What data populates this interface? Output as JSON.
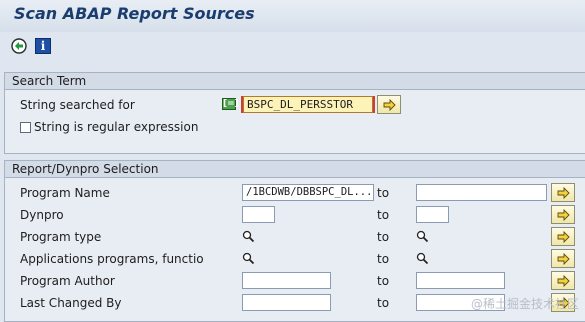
{
  "window": {
    "title": "Scan ABAP Report Sources"
  },
  "toolbar": {
    "execute_icon": "execute-icon",
    "info_icon": "info-icon",
    "info_glyph": "i"
  },
  "search_term": {
    "header": "Search Term",
    "string_label": "String searched for",
    "string_value": "BSPC_DL_PERSSTOR",
    "regex_label": "String is regular expression",
    "match_icon_glyph": "[=]"
  },
  "selection": {
    "header": "Report/Dynpro Selection",
    "to_label": "to",
    "rows": [
      {
        "label": "Program Name",
        "from": "/1BCDWB/DBBSPC_DL...",
        "to": ""
      },
      {
        "label": "Dynpro",
        "from": "",
        "to": ""
      },
      {
        "label": "Program type",
        "from": "",
        "to": ""
      },
      {
        "label": "Applications programs, functio",
        "from": "",
        "to": ""
      },
      {
        "label": "Program Author",
        "from": "",
        "to": ""
      },
      {
        "label": "Last Changed By",
        "from": "",
        "to": ""
      }
    ]
  },
  "watermark": "@稀土掘金技术社区",
  "colors": {
    "title": "#1a3d6e",
    "highlight_field": "#fdf3b8",
    "arrow_button": "#f1e7a8"
  }
}
